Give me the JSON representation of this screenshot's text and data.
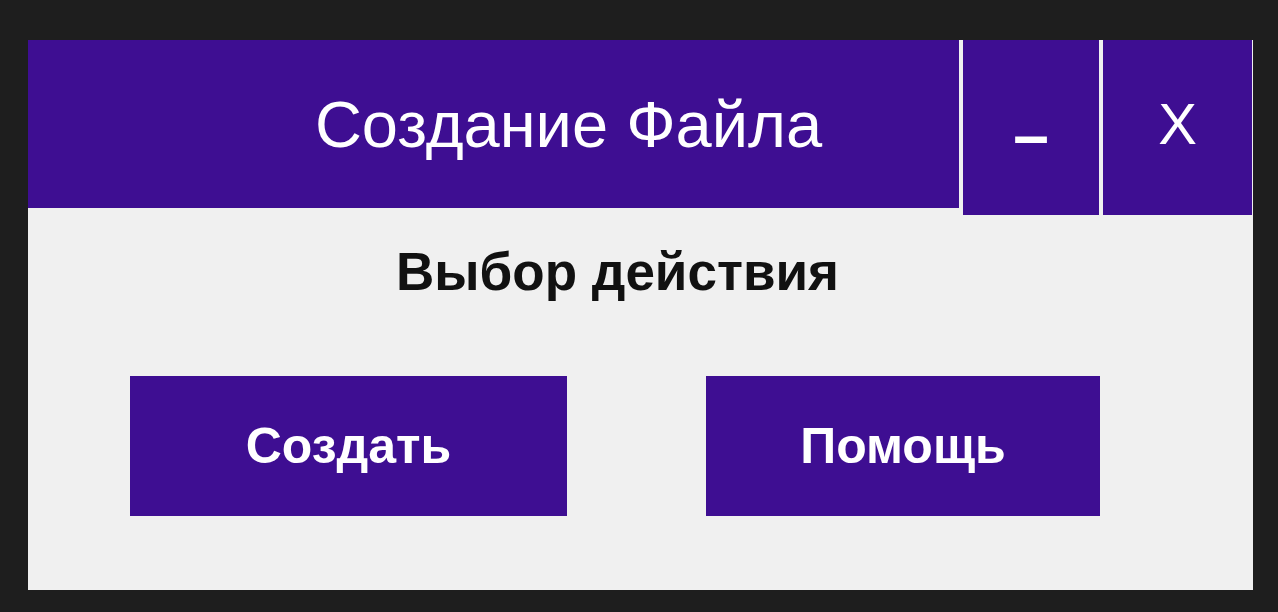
{
  "window": {
    "title": "Создание Файла",
    "controls": [
      {
        "kind": "minimize",
        "label": "–"
      },
      {
        "kind": "close",
        "label": "X"
      }
    ]
  },
  "prompt": "Выбор действия",
  "buttons": [
    "Создать",
    "Помощь"
  ]
}
